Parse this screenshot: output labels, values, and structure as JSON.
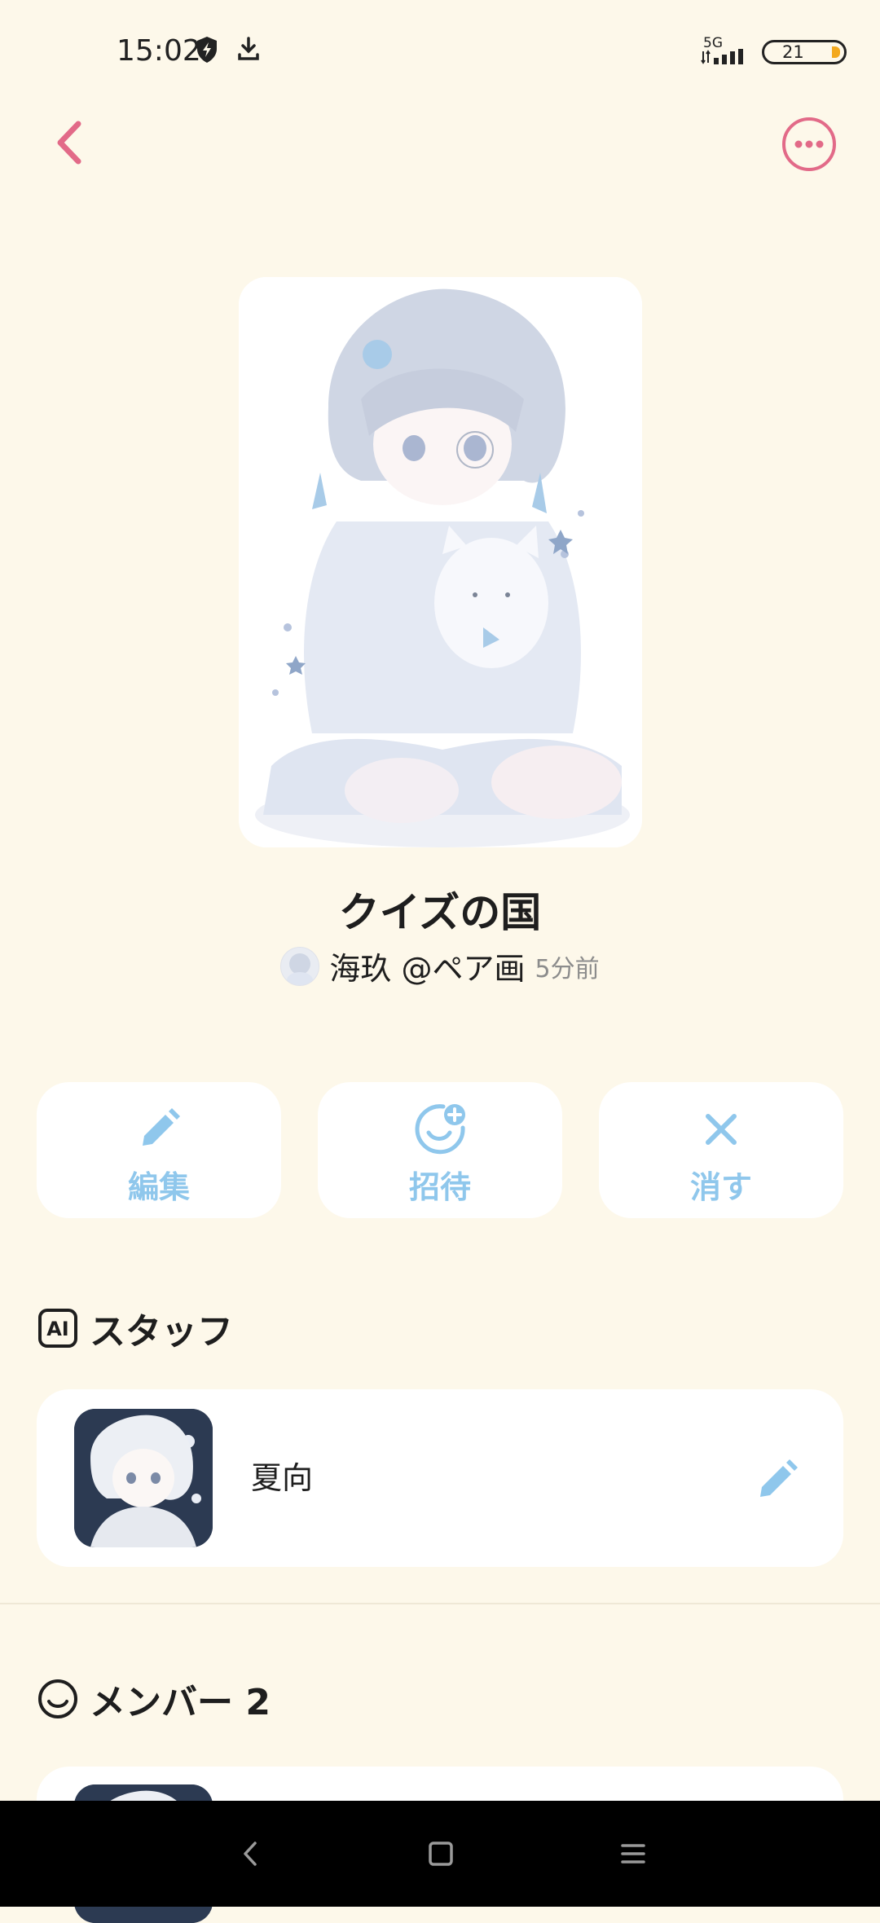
{
  "status_bar": {
    "time": "15:02",
    "network": "5G",
    "battery": "21",
    "battery_color": "#F3A91E"
  },
  "nav": {
    "back_icon": "chevron-left-icon",
    "more_icon": "ellipsis-circle-icon",
    "accent_color": "#E26A88"
  },
  "room": {
    "title": "クイズの国",
    "author": "海玖 @ペア画",
    "time_ago": "5分前"
  },
  "actions": [
    {
      "label": "編集",
      "icon": "pencil-icon"
    },
    {
      "label": "招待",
      "icon": "invite-smile-plus-icon"
    },
    {
      "label": "消す",
      "icon": "close-x-icon"
    }
  ],
  "action_color": "#8FC7EC",
  "staff_section": {
    "title": "スタッフ",
    "icon": "ai-badge-icon",
    "members": [
      {
        "name": "夏向",
        "edit_icon": "pencil-icon"
      }
    ]
  },
  "members_section": {
    "title": "メンバー 2",
    "icon": "smile-face-icon"
  }
}
